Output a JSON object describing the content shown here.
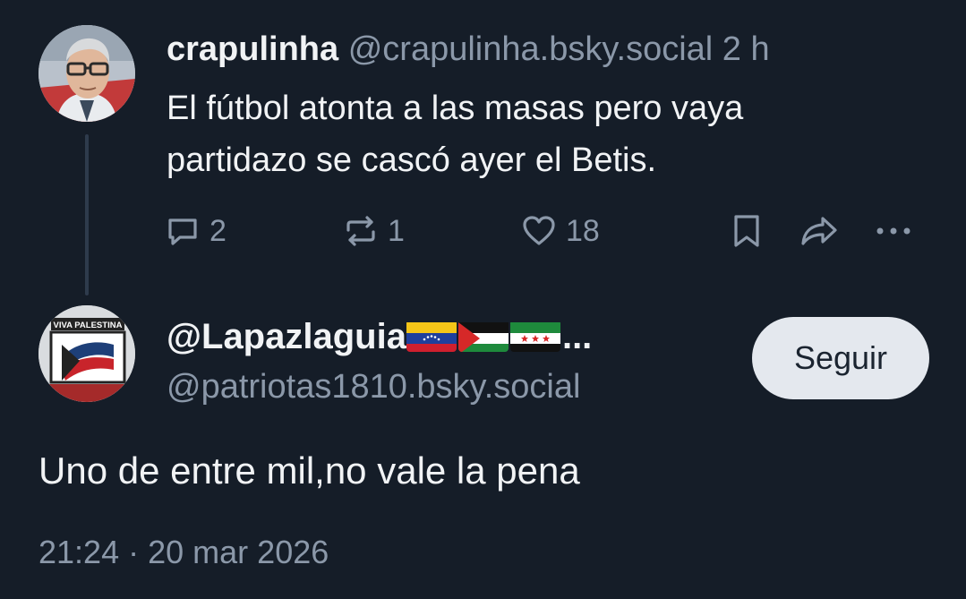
{
  "parent_post": {
    "display_name": "crapulinha",
    "handle": "@crapulinha.bsky.social",
    "time": "2 h",
    "text_line1": "El fútbol atonta a las masas pero vaya",
    "text_line2": "partidazo se cascó ayer el Betis.",
    "actions": {
      "reply_count": "2",
      "repost_count": "1",
      "like_count": "18"
    }
  },
  "reply_post": {
    "display_name": "@Lapazlaguia",
    "name_suffix": "...",
    "flags": [
      "venezuela-flag",
      "palestine-flag",
      "syria-flag"
    ],
    "handle": "@patriotas1810.bsky.social",
    "follow_label": "Seguir",
    "text": "Uno de entre mil,no vale la pena",
    "timestamp": "21:24",
    "separator": "·",
    "date": "20 mar 2026"
  },
  "avatar_badge_text": "VIVA PALESTINA",
  "colors": {
    "background": "#151d28",
    "text": "#f1f3f5",
    "muted": "#8b98a9",
    "thread_line": "#2e3b4c",
    "follow_button_bg": "#e4e8ee"
  },
  "icons": [
    "reply-icon",
    "repost-icon",
    "like-icon",
    "bookmark-icon",
    "share-icon",
    "more-icon"
  ]
}
